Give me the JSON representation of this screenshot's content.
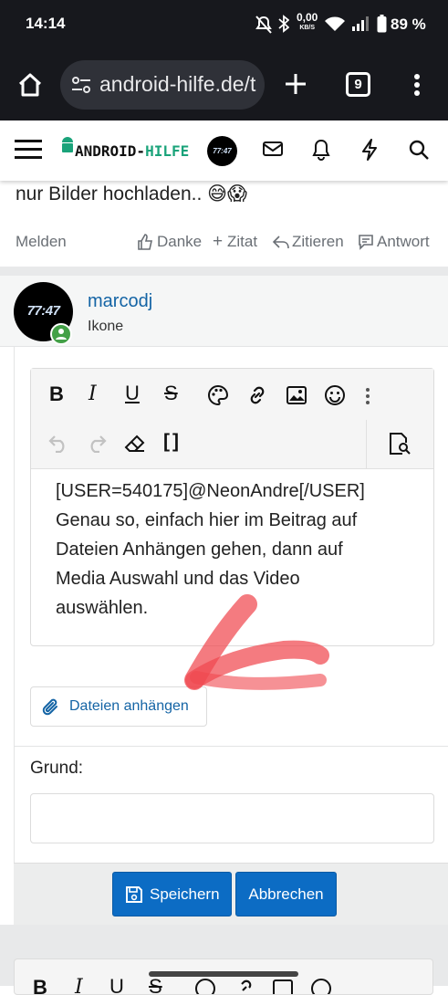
{
  "status_bar": {
    "time": "14:14",
    "net_speed_value": "0,00",
    "net_speed_unit": "KB/S",
    "battery": "89 %",
    "wifi_label": "4"
  },
  "browser": {
    "url": "android-hilfe.de/t",
    "tab_count": "9"
  },
  "site": {
    "logo_text_left": "ANDROID-",
    "logo_text_right": "HILFE",
    "colors": {
      "logo_green": "#1aa37a",
      "link_blue": "#1464a5",
      "button_blue": "#0c6cc4"
    }
  },
  "previous_post": {
    "text_tail": "nur Bilder hochladen..",
    "emoji": "😅😱",
    "actions": {
      "report": "Melden",
      "like": "Danke",
      "add_quote": "Zitat",
      "quote": "Zitieren",
      "reply": "Antwort"
    }
  },
  "user": {
    "name": "marcodj",
    "title": "Ikone",
    "avatar_text": "77:47"
  },
  "editor": {
    "text_lines": [
      "[USER=540175]@NeonAndre[/USER]",
      "Genau so, einfach hier im Beitrag auf",
      "Dateien Anhängen gehen, dann auf",
      "Media Auswahl und das Video",
      "auswählen."
    ],
    "attach_label": "Dateien anhängen"
  },
  "form": {
    "reason_label": "Grund:",
    "save_label": "Speichern",
    "cancel_label": "Abbrechen"
  }
}
